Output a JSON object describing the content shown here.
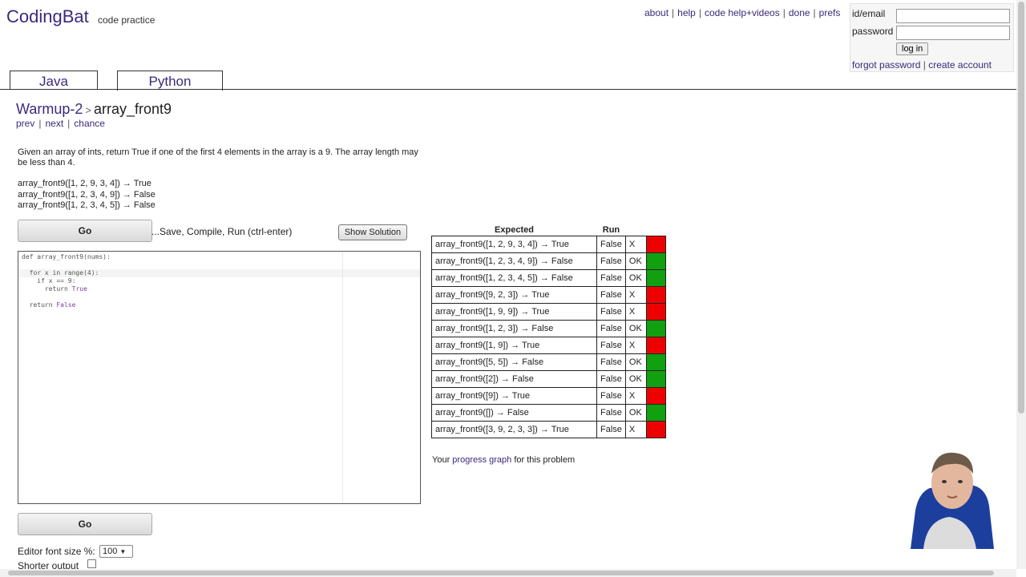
{
  "header": {
    "brand": "CodingBat",
    "brand_sub": "code practice",
    "nav": [
      "about",
      "help",
      "code help+videos",
      "done",
      "prefs"
    ]
  },
  "login": {
    "id_label": "id/email",
    "password_label": "password",
    "login_button": "log in",
    "forgot": "forgot password",
    "separator": "|",
    "create": "create account"
  },
  "tabs": [
    {
      "label": "Java",
      "active": false
    },
    {
      "label": "Python",
      "active": true
    }
  ],
  "problem": {
    "parent": "Warmup-2",
    "arrow": ">",
    "name": "array_front9",
    "nav": {
      "prev": "prev",
      "next": "next",
      "chance": "chance"
    },
    "description": "Given an array of ints, return True if one of the first 4 elements in the array is a 9. The array length may be less than 4.",
    "examples": [
      "array_front9([1, 2, 9, 3, 4]) → True",
      "array_front9([1, 2, 3, 4, 9]) → False",
      "array_front9([1, 2, 3, 4, 5]) → False"
    ]
  },
  "controls": {
    "go_label": "Go",
    "save_text": "...Save, Compile, Run (ctrl-enter)",
    "show_solution": "Show Solution",
    "font_size_label": "Editor font size %:",
    "font_size_value": "100",
    "shorter_output_label": "Shorter output"
  },
  "code_lines": [
    "def array_front9(nums):",
    "",
    "  for x in range(4):",
    "    if x == 9:",
    "      return True",
    "",
    "  return False"
  ],
  "results": {
    "headers": {
      "expected": "Expected",
      "run": "Run"
    },
    "rows": [
      {
        "expected": "array_front9([1, 2, 9, 3, 4]) → True",
        "run": "False",
        "mark": "X",
        "status": "fail"
      },
      {
        "expected": "array_front9([1, 2, 3, 4, 9]) → False",
        "run": "False",
        "mark": "OK",
        "status": "pass"
      },
      {
        "expected": "array_front9([1, 2, 3, 4, 5]) → False",
        "run": "False",
        "mark": "OK",
        "status": "pass"
      },
      {
        "expected": "array_front9([9, 2, 3]) → True",
        "run": "False",
        "mark": "X",
        "status": "fail"
      },
      {
        "expected": "array_front9([1, 9, 9]) → True",
        "run": "False",
        "mark": "X",
        "status": "fail"
      },
      {
        "expected": "array_front9([1, 2, 3]) → False",
        "run": "False",
        "mark": "OK",
        "status": "pass"
      },
      {
        "expected": "array_front9([1, 9]) → True",
        "run": "False",
        "mark": "X",
        "status": "fail"
      },
      {
        "expected": "array_front9([5, 5]) → False",
        "run": "False",
        "mark": "OK",
        "status": "pass"
      },
      {
        "expected": "array_front9([2]) → False",
        "run": "False",
        "mark": "OK",
        "status": "pass"
      },
      {
        "expected": "array_front9([9]) → True",
        "run": "False",
        "mark": "X",
        "status": "fail"
      },
      {
        "expected": "array_front9([]) → False",
        "run": "False",
        "mark": "OK",
        "status": "pass"
      },
      {
        "expected": "array_front9([3, 9, 2, 3, 3]) → True",
        "run": "False",
        "mark": "X",
        "status": "fail"
      }
    ],
    "progress_prefix": "Your ",
    "progress_link": "progress graph",
    "progress_suffix": " for this problem"
  },
  "colors": {
    "pass": "#10a010",
    "fail": "#ee0000",
    "link": "#3b2a7a"
  }
}
